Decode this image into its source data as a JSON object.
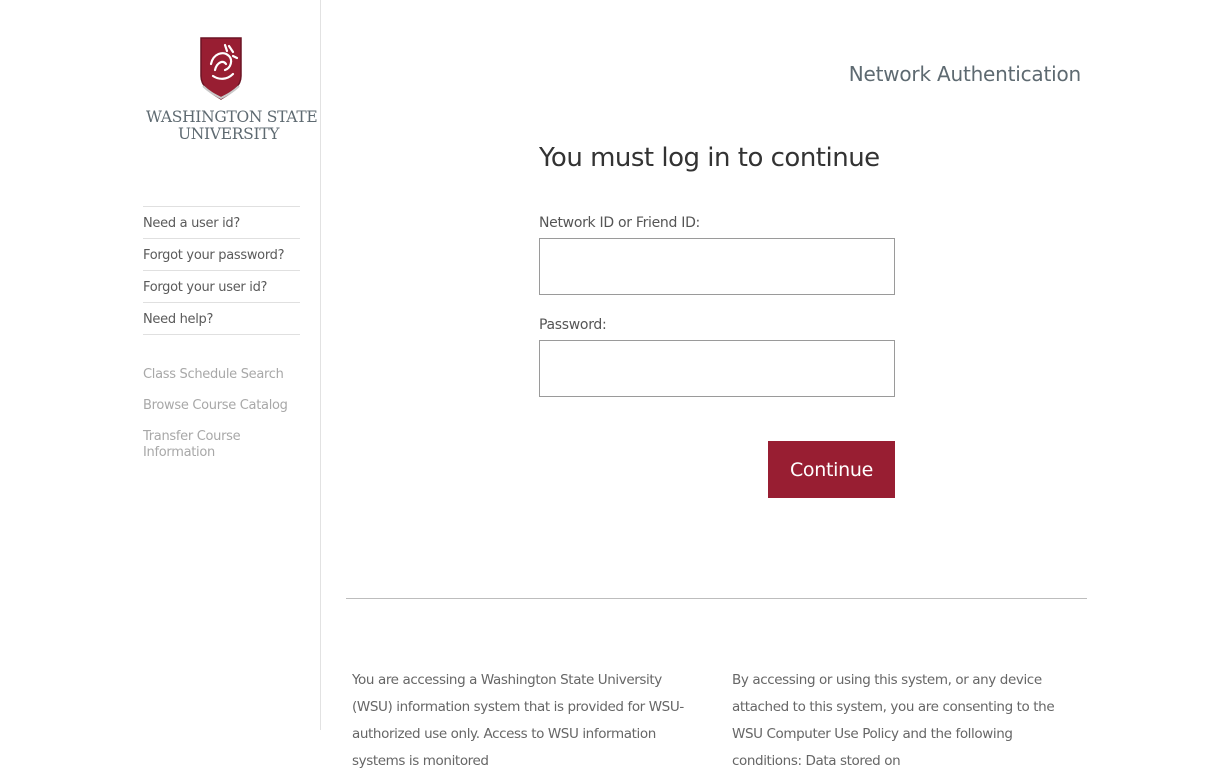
{
  "brand": {
    "logo_line1": "WASHINGTON STATE",
    "logo_line2": "UNIVERSITY",
    "crimson": "#981e32",
    "gray": "#5e6a71"
  },
  "sidebar": {
    "primary_links": [
      {
        "label": "Need a user id?"
      },
      {
        "label": "Forgot your password?"
      },
      {
        "label": "Forgot your user id?"
      },
      {
        "label": "Need help?"
      }
    ],
    "secondary_links": [
      {
        "label": "Class Schedule Search"
      },
      {
        "label": "Browse Course Catalog"
      },
      {
        "label": "Transfer Course Information"
      }
    ]
  },
  "header": {
    "title": "Network Authentication"
  },
  "form": {
    "heading": "You must log in to continue",
    "user_label": "Network ID or Friend ID:",
    "user_value": "",
    "password_label": "Password:",
    "password_value": "",
    "continue_label": "Continue"
  },
  "notice": {
    "left": "You are accessing a Washington State University (WSU) information system that is provided for WSU-authorized use only. Access to WSU information systems is monitored",
    "right": "By accessing or using this system, or any device attached to this system, you are consenting to the WSU Computer Use Policy and the following conditions: Data stored on"
  }
}
